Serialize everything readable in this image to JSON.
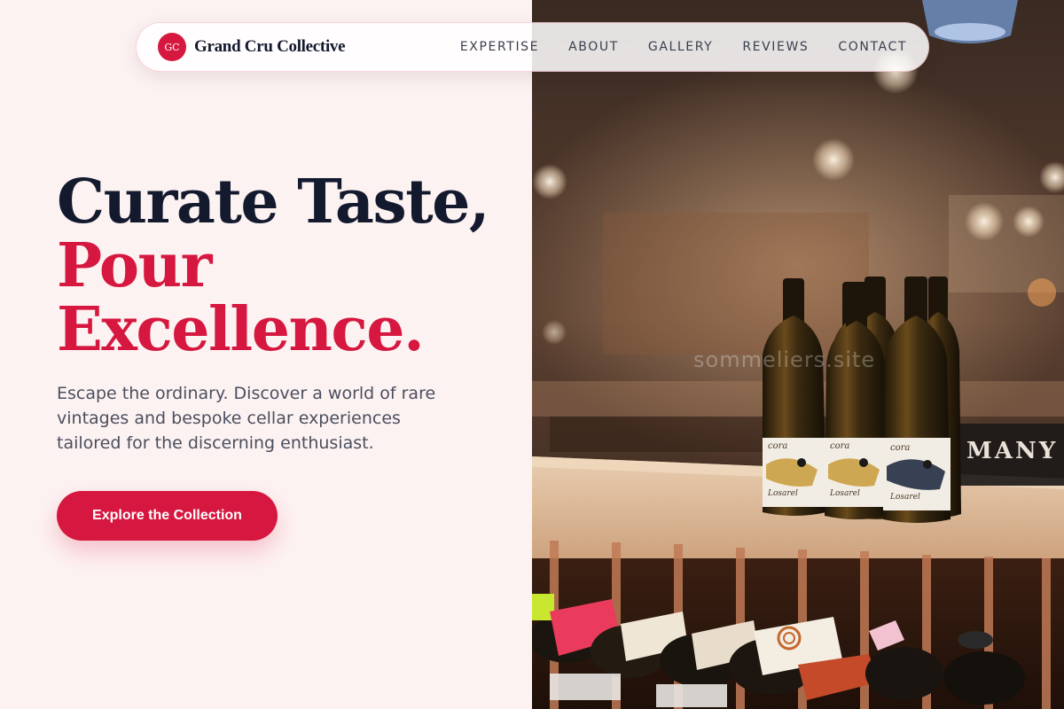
{
  "nav": {
    "logo_initials": "GC",
    "brand": "Grand Cru Collective",
    "links": [
      {
        "label": "EXPERTISE"
      },
      {
        "label": "ABOUT"
      },
      {
        "label": "GALLERY"
      },
      {
        "label": "REVIEWS"
      },
      {
        "label": "CONTACT"
      }
    ]
  },
  "hero": {
    "headline_line1": "Curate Taste,",
    "headline_line2": "Pour",
    "headline_line3": "Excellence.",
    "subtitle": "Escape the ordinary. Discover a world of rare vintages and bespoke cellar experiences tailored for the discerning enthusiast.",
    "cta_label": "Explore the Collection"
  },
  "photo": {
    "description_icon": "wine-bottles-photo",
    "watermark": "sommeliers.site",
    "shelf_sign": "MANY",
    "bottle_label_name": "cora",
    "bottle_label_maker": "Losarel"
  },
  "colors": {
    "accent": "#d6173f",
    "headline_dark": "#141a2e",
    "page_bg": "#fdf2f2",
    "body_text": "#4a4f5e"
  }
}
